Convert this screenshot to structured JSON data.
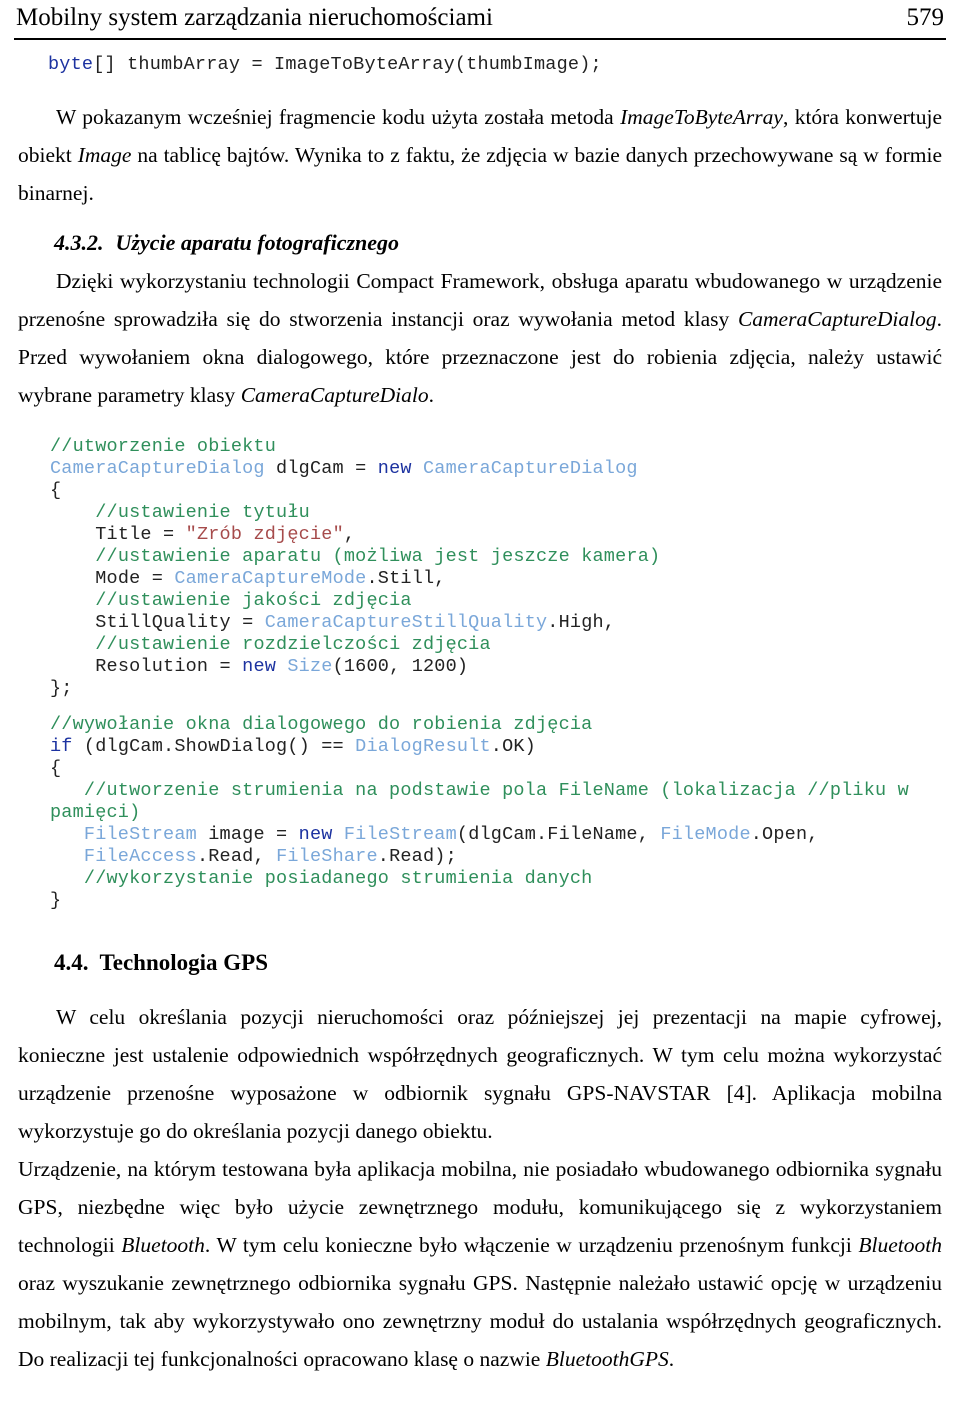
{
  "header": {
    "title": "Mobilny system zarządzania nieruchomościami",
    "page_number": "579"
  },
  "code_top": {
    "keyword": "byte",
    "rest": "[] thumbArray = ImageToByteArray(thumbImage);"
  },
  "paragraph_1": {
    "part1": "W pokazanym wcześniej fragmencie kodu użyta została metoda ",
    "italic1": "ImageToByteArray",
    "part2": ", która konwertuje obiekt ",
    "italic2": "Image",
    "part3": " na tablicę bajtów. Wynika to z faktu, że zdjęcia w bazie danych przechowywane są w formie binarnej."
  },
  "heading_432": {
    "number": "4.3.2.",
    "text": "Użycie aparatu fotograficznego"
  },
  "paragraph_2": {
    "part1": "Dzięki wykorzystaniu technologii Compact Framework, obsługa aparatu wbudowanego w urządzenie przenośne sprowadziła się do stworzenia instancji oraz wywołania metod klasy ",
    "italic1": "CameraCaptureDialog",
    "part2": ". Przed wywołaniem okna dialogowego, które przeznaczone jest do robienia zdjęcia, należy ustawić wybrane parametry klasy ",
    "italic2": "CameraCaptureDialo",
    "part3": "."
  },
  "code_block_1": {
    "l1_comment": "//utworzenie obiektu",
    "l2_type1": "CameraCaptureDialog",
    "l2_mid": " dlgCam = ",
    "l2_kw": "new",
    "l2_type2": " CameraCaptureDialog",
    "l3": "{",
    "l4_comment": "    //ustawienie tytułu",
    "l5_plain": "    Title = ",
    "l5_string": "\"Zrób zdjęcie\"",
    "l5_tail": ",",
    "l6_comment": "    //ustawienie aparatu (możliwa jest jeszcze kamera)",
    "l7_plain": "    Mode = ",
    "l7_type": "CameraCaptureMode",
    "l7_tail": ".Still,",
    "l8_comment": "    //ustawienie jakości zdjęcia",
    "l9_plain": "    StillQuality = ",
    "l9_type": "CameraCaptureStillQuality",
    "l9_tail": ".High,",
    "l10_comment": "    //ustawienie rozdzielczości zdjęcia",
    "l11_plain": "    Resolution = ",
    "l11_kw": "new",
    "l11_type": " Size",
    "l11_tail": "(1600, 1200)",
    "l12": "};"
  },
  "code_block_2": {
    "l1_comment": "//wywołanie okna dialogowego do robienia zdjęcia",
    "l2_kw": "if",
    "l2_plain": " (dlgCam.ShowDialog() == ",
    "l2_type": "DialogResult",
    "l2_tail": ".OK)",
    "l3": "{",
    "l4_comment": "   //utworzenie strumienia na podstawie pola FileName (lokalizacja //pliku w pamięci)",
    "l5_type1": "   FileStream",
    "l5_mid1": " image = ",
    "l5_kw": "new",
    "l5_type2": " FileStream",
    "l5_mid2": "(dlgCam.FileName, ",
    "l5_type3": "FileMode",
    "l5_tail": ".Open,",
    "l6_type1": "   FileAccess",
    "l6_mid1": ".Read, ",
    "l6_type2": "FileShare",
    "l6_tail": ".Read);",
    "l7_comment": "   //wykorzystanie posiadanego strumienia danych",
    "l8": "}"
  },
  "heading_44": {
    "number": "4.4.",
    "text": "Technologia GPS"
  },
  "paragraph_3": {
    "text": "W celu określania pozycji nieruchomości oraz późniejszej jej prezentacji na mapie cyfrowej, konieczne jest ustalenie odpowiednich współrzędnych geograficznych. W tym celu można wykorzystać urządzenie przenośne wyposażone w odbiornik sygnału GPS-NAVSTAR [4]. Aplikacja mobilna wykorzystuje go do określania pozycji danego obiektu."
  },
  "paragraph_4": {
    "part1": "Urządzenie, na którym testowana była aplikacja mobilna, nie posiadało wbudowanego odbiornika sygnału GPS, niezbędne więc było użycie zewnętrznego modułu, komunikującego się z wykorzystaniem technologii ",
    "italic1": "Bluetooth",
    "part2": ". W tym celu konieczne było włączenie w urządzeniu przenośnym funkcji ",
    "italic2": "Bluetooth",
    "part3": " oraz wyszukanie zewnętrznego odbiornika sygnału GPS. Następnie należało ustawić opcję w urządzeniu mobilnym, tak aby wykorzystywało ono zewnętrzny moduł do ustalania współrzędnych geograficznych. Do realizacji tej funkcjonalności opracowano klasę o nazwie ",
    "italic3": "BluetoothGPS",
    "part4": "."
  }
}
